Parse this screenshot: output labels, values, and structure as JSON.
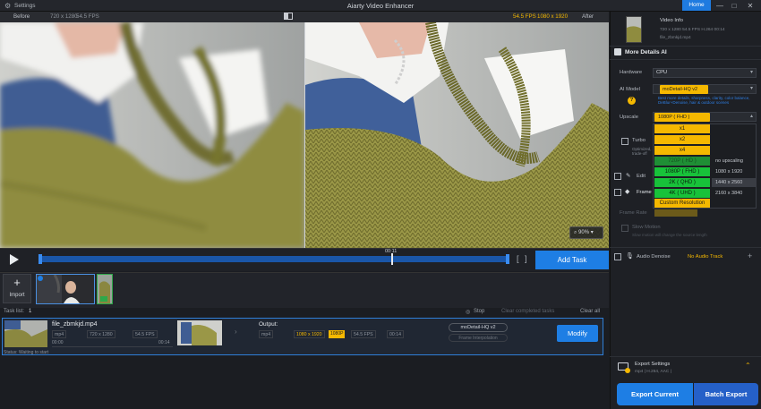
{
  "titlebar": {
    "settings": "Settings",
    "title": "Aiarty Video Enhancer",
    "home": "Home",
    "min": "—",
    "max": "□",
    "close": "✕"
  },
  "compare": {
    "before": "Before",
    "before_res": "720 x 1280",
    "before_fps": "54.5 FPS",
    "after": "After",
    "after_res": "1080 x 1920",
    "after_fps": "54.5 FPS"
  },
  "viewer": {
    "zoom": "90%"
  },
  "timeline": {
    "timecode": "00:11",
    "add_task": "Add Task"
  },
  "import": {
    "label": "Import",
    "plus": "+"
  },
  "tasks": {
    "count_label": "Task list:",
    "count": "1",
    "stop": "Stop",
    "clear_completed": "Clear completed tasks",
    "clear_all": "Clear all",
    "item": {
      "filename": "file_zbmkjd.mp4",
      "format": "mp4",
      "resolution": "720 x 1280",
      "fps": "54.5 FPS",
      "time_start": "00:00",
      "time_end": "00:14",
      "output_label": "Output:",
      "out_format": "mp4",
      "out_resolution": "1080 x 1920",
      "out_badge": "1080P",
      "out_fps": "54.5 FPS",
      "out_duration": "00:14",
      "model": "moDetail-HQ  v2",
      "frame_interp": "Frame Interpolation",
      "modify": "Modify",
      "status": "Status: Waiting to start"
    }
  },
  "panel": {
    "video_info": {
      "title": "Video Info",
      "line1": "720 x 1280  54.5 FPS  H.264  00:14",
      "line2": "file_zbmkjd.mp4"
    },
    "section_title": "More Details AI",
    "hardware_label": "Hardware",
    "hardware_value": "CPU",
    "aimodel_label": "AI Model",
    "aimodel_value": "moDetail-HQ  v2",
    "aimodel_desc": "Best more details, sharpness, clarity, color balance, DeBlur+Denoise, hair & outdoor scenes",
    "upscale_label": "Upscale",
    "upscale_value": "1080P  ( FHD )",
    "options": [
      "x1",
      "x2",
      "x4",
      "720P ( HD )",
      "1080P ( FHD )",
      "2K ( QHD )",
      "4K ( UHD )",
      "Custom Resolution"
    ],
    "option_res": [
      "no upscaling",
      "1080 x 1920",
      "1440 x 2560",
      "2160 x 3840"
    ],
    "turbo_label": "Turbo",
    "turbo_desc": "Optimized, speed\ntrade-off",
    "edit_label": "Edit",
    "frame_label": "Frame I",
    "frame_rate_label": "Frame Rate",
    "slow_motion": "Slow Motion",
    "slow_desc": "Slow motion will change the source length",
    "audio_denoise": "Audio Denoise",
    "audio_track": "No Audio Track",
    "export_settings": "Export Settings",
    "export_sub": "mp4 | H.264, AAC |",
    "export_current": "Export Current",
    "batch_export": "Batch Export"
  },
  "icons": {
    "play": "play-icon",
    "settings": "gear-icon",
    "mic": "mic-icon"
  }
}
